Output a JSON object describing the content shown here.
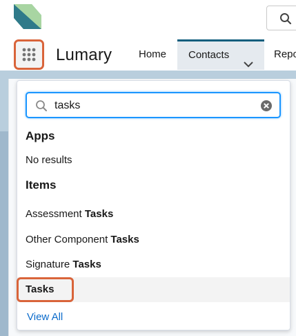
{
  "header": {
    "logo_icon": "lumary-logo",
    "search_icon": "search-icon"
  },
  "nav": {
    "app_name": "Lumary",
    "launcher_icon": "app-launcher-grid-icon",
    "tabs": [
      {
        "label": "Home"
      },
      {
        "label": "Contacts",
        "active": true
      },
      {
        "label": "Repo"
      }
    ]
  },
  "launcher_menu": {
    "search": {
      "value": "tasks",
      "placeholder": ""
    },
    "apps_heading": "Apps",
    "apps_empty": "No results",
    "items_heading": "Items",
    "items": [
      {
        "prefix": "Assessment ",
        "match": "Tasks"
      },
      {
        "prefix": "Other Component ",
        "match": "Tasks"
      },
      {
        "prefix": "Signature ",
        "match": "Tasks"
      },
      {
        "prefix": "",
        "match": "Tasks",
        "selected": true
      }
    ],
    "view_all": "View All"
  },
  "colors": {
    "accent": "#0f5e7d",
    "highlight": "#d9643a",
    "link": "#0b6bcb",
    "focus": "#1b96ff"
  }
}
